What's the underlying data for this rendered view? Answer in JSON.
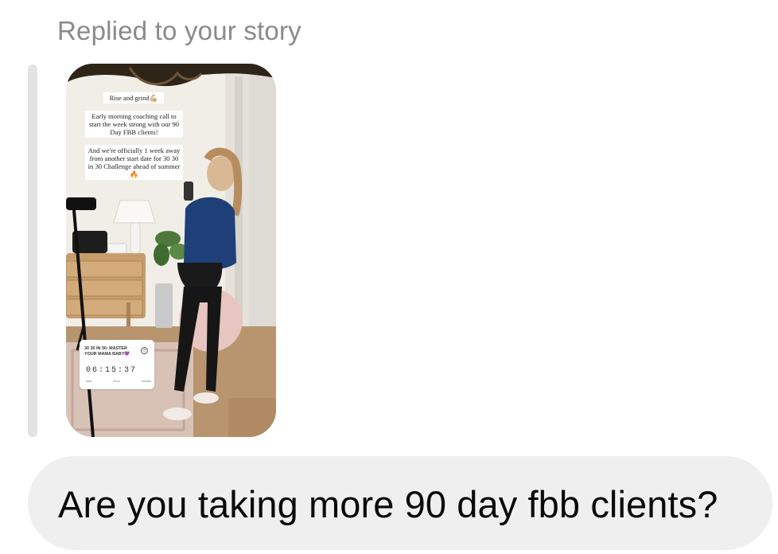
{
  "reply_header": "Replied to your story",
  "story": {
    "text_1": "Rise and grind💪🏼",
    "text_2": "Early morning coaching call to start the week strong with our 90 Day FBB clients!",
    "text_3": "And we're officially 1 week away from another start date for 30 30 in 30 Challenge ahead of summer🔥",
    "countdown": {
      "title": "30 30 IN 30: MASTER YOUR MAMA BABY💜",
      "digits": "06:15:37",
      "labels": [
        "days",
        "hours",
        "minutes"
      ]
    }
  },
  "message": {
    "text": "Are you taking more 90 day fbb clients?"
  },
  "colors": {
    "header_text": "#8a8a8e",
    "quote_bar": "#e3e3e6",
    "bubble_bg": "#efefef"
  }
}
